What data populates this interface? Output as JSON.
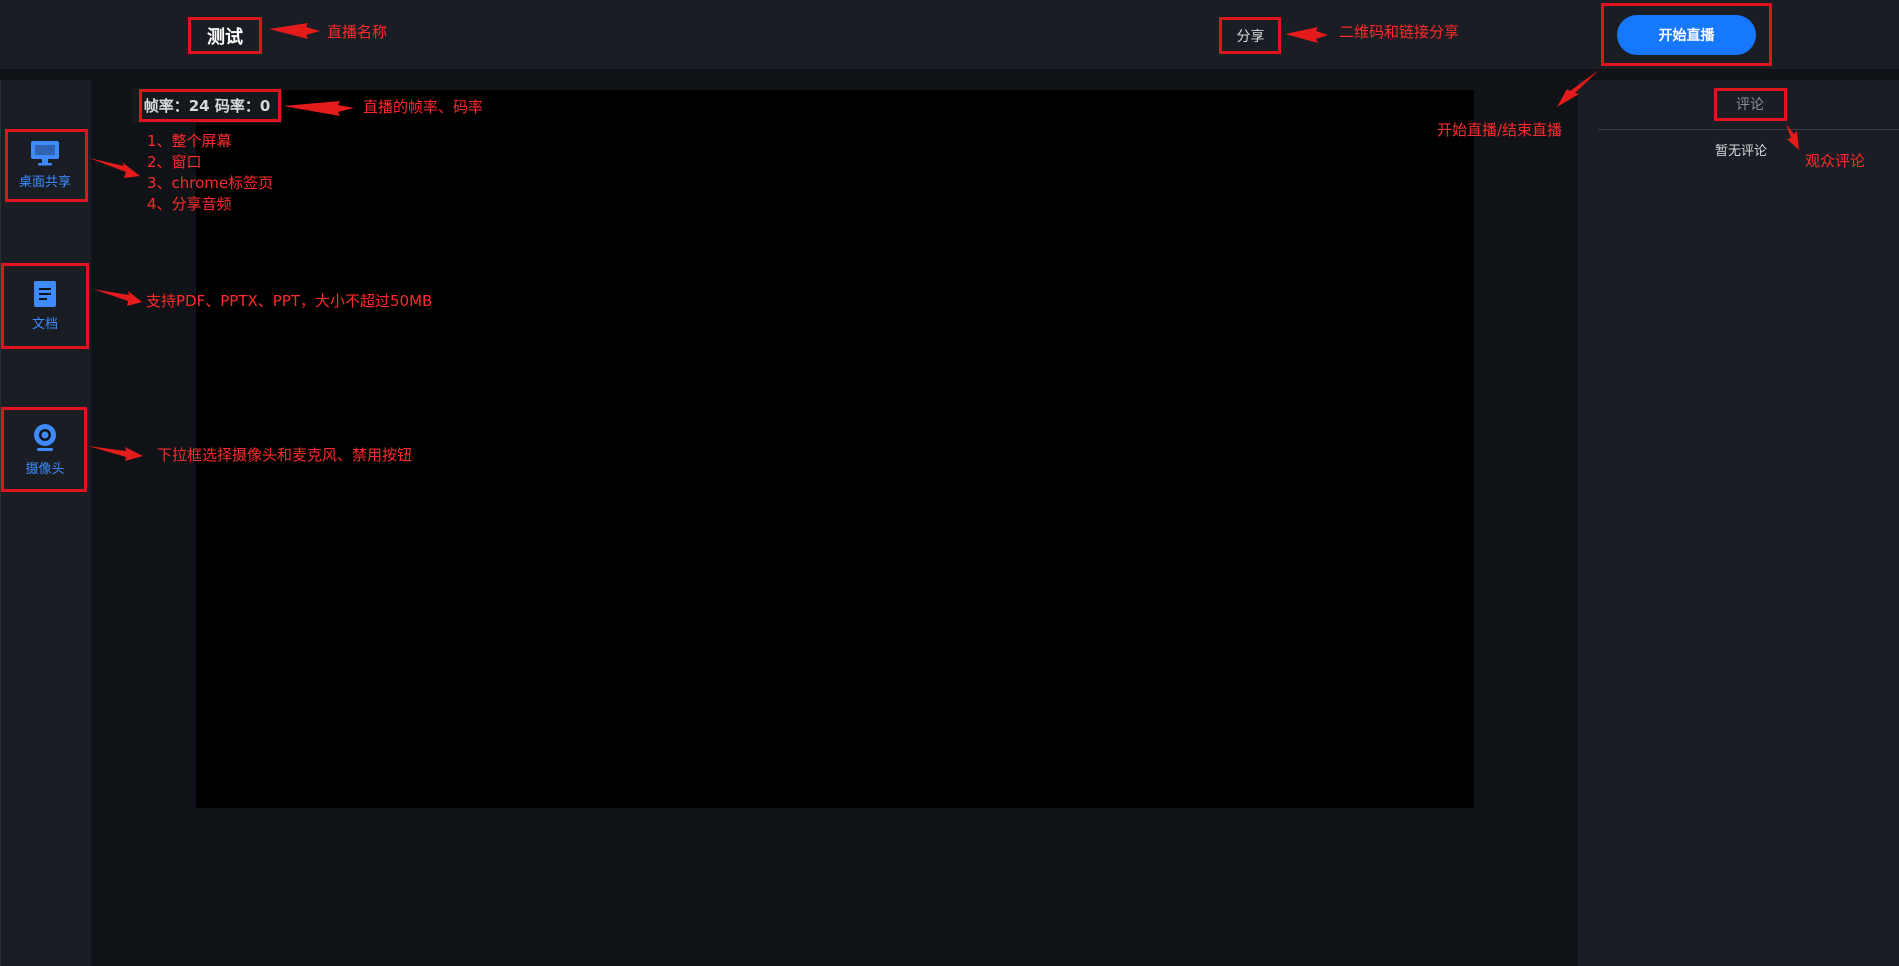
{
  "header": {
    "title": "测试",
    "share_label": "分享",
    "start_label": "开始直播"
  },
  "stream_stats": {
    "text": "帧率：24 码率：0",
    "frame_rate": 24,
    "bit_rate": 0
  },
  "sidebar": {
    "items": [
      {
        "label": "桌面共享",
        "icon": "monitor-icon"
      },
      {
        "label": "文档",
        "icon": "document-icon"
      },
      {
        "label": "摄像头",
        "icon": "webcam-icon"
      }
    ]
  },
  "comments": {
    "tab_label": "评论",
    "empty_text": "暂无评论"
  },
  "annotations": {
    "title_note": "直播名称",
    "share_note": "二维码和链接分享",
    "start_note": "开始直播/结束直播",
    "stats_note": "直播的帧率、码率",
    "comment_note": "观众评论",
    "desktop_notes": [
      "1、整个屏幕",
      "2、窗口",
      "3、chrome标签页",
      "4、分享音频"
    ],
    "document_note": "支持PDF、PPTX、PPT，大小不超过50MB",
    "camera_note": "下拉框选择摄像头和麦克风、禁用按钮"
  },
  "colors": {
    "accent": "#1677ff",
    "annotation_red": "#e0141e",
    "panel_bg": "#1a1d23",
    "video_bg": "#000000"
  }
}
